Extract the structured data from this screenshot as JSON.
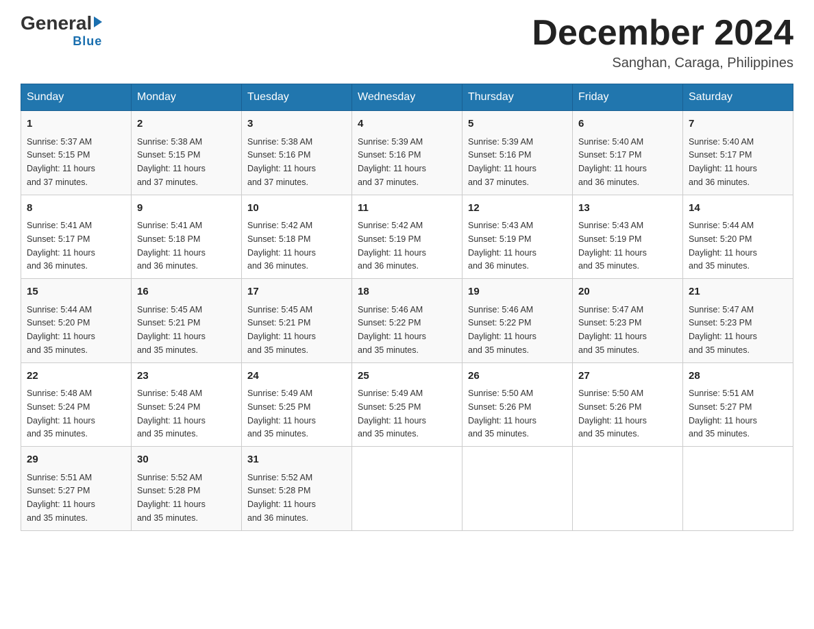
{
  "header": {
    "logo_general": "General",
    "logo_blue": "Blue",
    "month_title": "December 2024",
    "location": "Sanghan, Caraga, Philippines"
  },
  "days_of_week": [
    "Sunday",
    "Monday",
    "Tuesday",
    "Wednesday",
    "Thursday",
    "Friday",
    "Saturday"
  ],
  "weeks": [
    [
      {
        "day": "1",
        "sunrise": "5:37 AM",
        "sunset": "5:15 PM",
        "daylight": "11 hours and 37 minutes."
      },
      {
        "day": "2",
        "sunrise": "5:38 AM",
        "sunset": "5:15 PM",
        "daylight": "11 hours and 37 minutes."
      },
      {
        "day": "3",
        "sunrise": "5:38 AM",
        "sunset": "5:16 PM",
        "daylight": "11 hours and 37 minutes."
      },
      {
        "day": "4",
        "sunrise": "5:39 AM",
        "sunset": "5:16 PM",
        "daylight": "11 hours and 37 minutes."
      },
      {
        "day": "5",
        "sunrise": "5:39 AM",
        "sunset": "5:16 PM",
        "daylight": "11 hours and 37 minutes."
      },
      {
        "day": "6",
        "sunrise": "5:40 AM",
        "sunset": "5:17 PM",
        "daylight": "11 hours and 36 minutes."
      },
      {
        "day": "7",
        "sunrise": "5:40 AM",
        "sunset": "5:17 PM",
        "daylight": "11 hours and 36 minutes."
      }
    ],
    [
      {
        "day": "8",
        "sunrise": "5:41 AM",
        "sunset": "5:17 PM",
        "daylight": "11 hours and 36 minutes."
      },
      {
        "day": "9",
        "sunrise": "5:41 AM",
        "sunset": "5:18 PM",
        "daylight": "11 hours and 36 minutes."
      },
      {
        "day": "10",
        "sunrise": "5:42 AM",
        "sunset": "5:18 PM",
        "daylight": "11 hours and 36 minutes."
      },
      {
        "day": "11",
        "sunrise": "5:42 AM",
        "sunset": "5:19 PM",
        "daylight": "11 hours and 36 minutes."
      },
      {
        "day": "12",
        "sunrise": "5:43 AM",
        "sunset": "5:19 PM",
        "daylight": "11 hours and 36 minutes."
      },
      {
        "day": "13",
        "sunrise": "5:43 AM",
        "sunset": "5:19 PM",
        "daylight": "11 hours and 35 minutes."
      },
      {
        "day": "14",
        "sunrise": "5:44 AM",
        "sunset": "5:20 PM",
        "daylight": "11 hours and 35 minutes."
      }
    ],
    [
      {
        "day": "15",
        "sunrise": "5:44 AM",
        "sunset": "5:20 PM",
        "daylight": "11 hours and 35 minutes."
      },
      {
        "day": "16",
        "sunrise": "5:45 AM",
        "sunset": "5:21 PM",
        "daylight": "11 hours and 35 minutes."
      },
      {
        "day": "17",
        "sunrise": "5:45 AM",
        "sunset": "5:21 PM",
        "daylight": "11 hours and 35 minutes."
      },
      {
        "day": "18",
        "sunrise": "5:46 AM",
        "sunset": "5:22 PM",
        "daylight": "11 hours and 35 minutes."
      },
      {
        "day": "19",
        "sunrise": "5:46 AM",
        "sunset": "5:22 PM",
        "daylight": "11 hours and 35 minutes."
      },
      {
        "day": "20",
        "sunrise": "5:47 AM",
        "sunset": "5:23 PM",
        "daylight": "11 hours and 35 minutes."
      },
      {
        "day": "21",
        "sunrise": "5:47 AM",
        "sunset": "5:23 PM",
        "daylight": "11 hours and 35 minutes."
      }
    ],
    [
      {
        "day": "22",
        "sunrise": "5:48 AM",
        "sunset": "5:24 PM",
        "daylight": "11 hours and 35 minutes."
      },
      {
        "day": "23",
        "sunrise": "5:48 AM",
        "sunset": "5:24 PM",
        "daylight": "11 hours and 35 minutes."
      },
      {
        "day": "24",
        "sunrise": "5:49 AM",
        "sunset": "5:25 PM",
        "daylight": "11 hours and 35 minutes."
      },
      {
        "day": "25",
        "sunrise": "5:49 AM",
        "sunset": "5:25 PM",
        "daylight": "11 hours and 35 minutes."
      },
      {
        "day": "26",
        "sunrise": "5:50 AM",
        "sunset": "5:26 PM",
        "daylight": "11 hours and 35 minutes."
      },
      {
        "day": "27",
        "sunrise": "5:50 AM",
        "sunset": "5:26 PM",
        "daylight": "11 hours and 35 minutes."
      },
      {
        "day": "28",
        "sunrise": "5:51 AM",
        "sunset": "5:27 PM",
        "daylight": "11 hours and 35 minutes."
      }
    ],
    [
      {
        "day": "29",
        "sunrise": "5:51 AM",
        "sunset": "5:27 PM",
        "daylight": "11 hours and 35 minutes."
      },
      {
        "day": "30",
        "sunrise": "5:52 AM",
        "sunset": "5:28 PM",
        "daylight": "11 hours and 35 minutes."
      },
      {
        "day": "31",
        "sunrise": "5:52 AM",
        "sunset": "5:28 PM",
        "daylight": "11 hours and 36 minutes."
      },
      null,
      null,
      null,
      null
    ]
  ],
  "labels": {
    "sunrise": "Sunrise:",
    "sunset": "Sunset:",
    "daylight": "Daylight:"
  }
}
